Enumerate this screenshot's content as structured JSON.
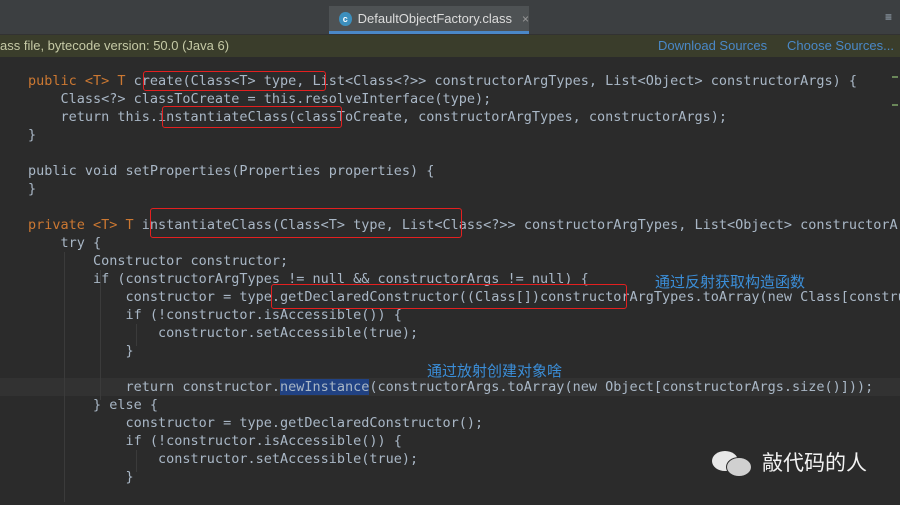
{
  "tab": {
    "icon_letter": "c",
    "title": "DefaultObjectFactory.class",
    "close": "×",
    "menu": "≡"
  },
  "banner": {
    "info": "ass file, bytecode version: 50.0 (Java 6)",
    "download": "Download Sources",
    "choose": "Choose Sources..."
  },
  "code": {
    "l1": {
      "a": "public <T> T ",
      "b": "create(Class<T> type",
      "c": ", List<Class<?>> constructorArgTypes, List<Object> constructorArgs) {"
    },
    "l2": "    Class<?> classToCreate = this.resolveInterface(type);",
    "l3": {
      "a": "    return this",
      "b": ".instantiateClass(",
      "c": "classToCreate, constructorArgTypes, constructorArgs);"
    },
    "l4": "}",
    "l6": "public void setProperties(Properties properties) {",
    "l7": "}",
    "l9": {
      "a": "private <T> T ",
      "b": "instantiateClass(Class<T> type, Lis",
      "c": "t<Class<?>> constructorArgTypes, List<Object> constructorArgs) {"
    },
    "l10": "    try {",
    "l11": "        Constructor constructor;",
    "l12": "        if (constructorArgTypes != null && constructorArgs != null) {",
    "l13": {
      "a": "            constructor = ty",
      "b": "pe.getDeclaredConstructor((Class[])co",
      "c": "nstructorArgTypes.toArray(new Class[constructorArgTypes.size()]));"
    },
    "l14": "            if (!constructor.isAccessible()) {",
    "l15": "                constructor.setAccessible(true);",
    "l16": "            }",
    "l18": {
      "a": "            return constructor.",
      "b": "newInstance",
      "c": "(constructorArgs.toArray(new Object[constructorArgs.size()]));"
    },
    "l19": "        } else {",
    "l20": "            constructor = type.getDeclaredConstructor();",
    "l21": "            if (!constructor.isAccessible()) {",
    "l22": "                constructor.setAccessible(true);",
    "l23": "            }"
  },
  "annotations": {
    "reflect_constructor": "通过反射获取构造函数",
    "reflect_create": "通过放射创建对象啥"
  },
  "watermark": {
    "text": "敲代码的人"
  }
}
